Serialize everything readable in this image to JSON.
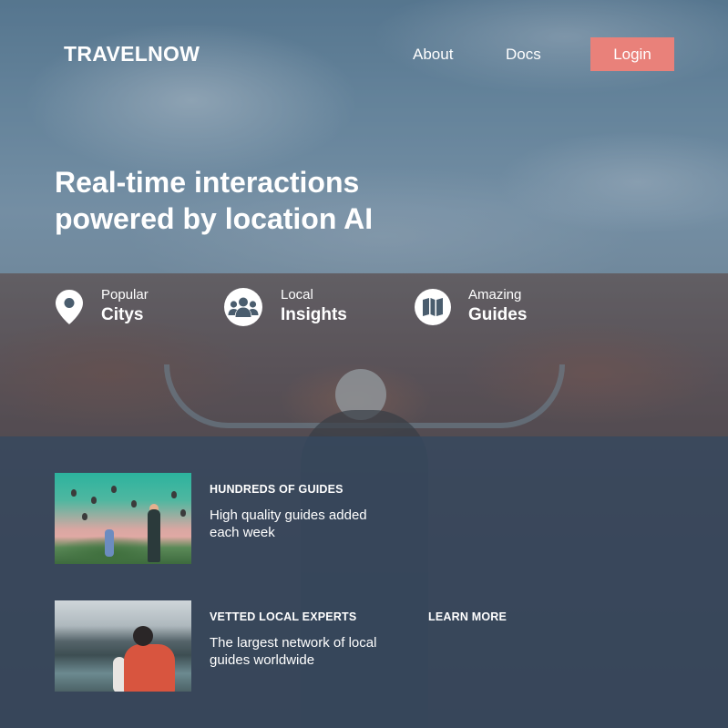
{
  "header": {
    "brand": "TRAVELNOW",
    "nav": {
      "about": "About",
      "docs": "Docs"
    },
    "login_label": "Login"
  },
  "hero": {
    "title_line1": "Real-time interactions",
    "title_line2": "powered by location AI"
  },
  "features": [
    {
      "small": "Popular",
      "big": "Citys",
      "icon": "map-pin-icon"
    },
    {
      "small": "Local",
      "big": "Insights",
      "icon": "users-icon"
    },
    {
      "small": "Amazing",
      "big": "Guides",
      "icon": "map-icon"
    }
  ],
  "cards": [
    {
      "heading": "HUNDREDS OF GUIDES",
      "text": "High quality guides added each week",
      "image": "hot-air-balloons-photo"
    },
    {
      "heading": "VETTED LOCAL EXPERTS",
      "text": "The largest network of local guides worldwide",
      "image": "hiker-lake-photo"
    }
  ],
  "learn_more_label": "LEARN MORE",
  "colors": {
    "accent": "#e9817a",
    "panel": "#344860",
    "text": "#ffffff"
  }
}
